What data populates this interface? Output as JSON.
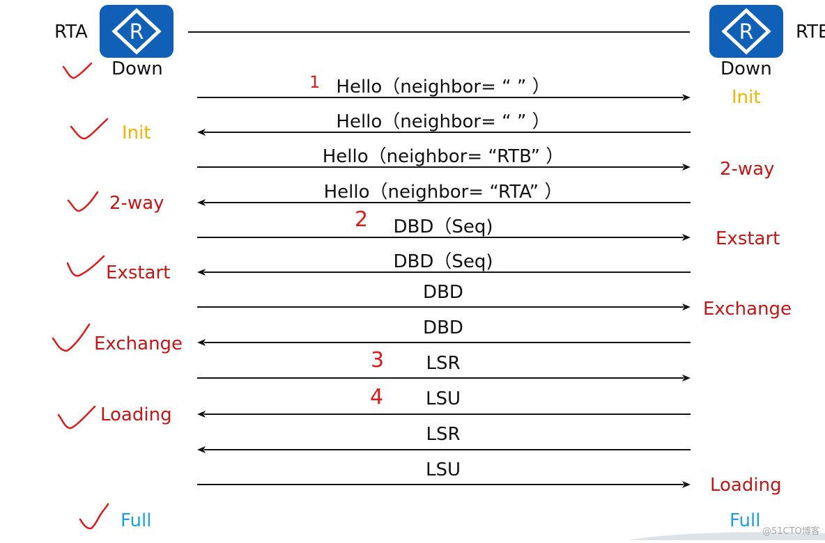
{
  "routers": {
    "left": {
      "label": "RTA",
      "icon_letter": "R",
      "icon": "router-icon",
      "color": "#1060b8"
    },
    "right": {
      "label": "RTB",
      "icon_letter": "R",
      "icon": "router-icon",
      "color": "#1060b8"
    }
  },
  "left_states": [
    {
      "label": "Down",
      "color": "black",
      "checked": true
    },
    {
      "label": "Init",
      "color": "yellow",
      "checked": true
    },
    {
      "label": "2-way",
      "color": "red",
      "checked": true
    },
    {
      "label": "Exstart",
      "color": "red",
      "checked": true
    },
    {
      "label": "Exchange",
      "color": "red",
      "checked": true
    },
    {
      "label": "Loading",
      "color": "red",
      "checked": true
    },
    {
      "label": "Full",
      "color": "blue",
      "checked": true
    }
  ],
  "right_states": [
    {
      "label": "Down",
      "color": "black"
    },
    {
      "label": "Init",
      "color": "yellow"
    },
    {
      "label": "2-way",
      "color": "red"
    },
    {
      "label": "Exstart",
      "color": "red"
    },
    {
      "label": "Exchange",
      "color": "red"
    },
    {
      "label": "Loading",
      "color": "red"
    },
    {
      "label": "Full",
      "color": "blue"
    }
  ],
  "messages": [
    {
      "text": "Hello（neighbor= “ ” ）",
      "direction": "right",
      "step": "1"
    },
    {
      "text": "Hello（neighbor= “ ” ）",
      "direction": "left",
      "step": ""
    },
    {
      "text": "Hello（neighbor= “RTB” ）",
      "direction": "right",
      "step": ""
    },
    {
      "text": "Hello（neighbor= “RTA” ）",
      "direction": "left",
      "step": ""
    },
    {
      "text": "DBD（Seq)",
      "direction": "right",
      "step": "2"
    },
    {
      "text": "DBD（Seq)",
      "direction": "left",
      "step": ""
    },
    {
      "text": "DBD",
      "direction": "right",
      "step": ""
    },
    {
      "text": "DBD",
      "direction": "left",
      "step": ""
    },
    {
      "text": "LSR",
      "direction": "right",
      "step": "3"
    },
    {
      "text": "LSU",
      "direction": "left",
      "step": "4"
    },
    {
      "text": "LSR",
      "direction": "left",
      "step": ""
    },
    {
      "text": "LSU",
      "direction": "right",
      "step": ""
    }
  ],
  "watermark": "@51CTO博客",
  "colors": {
    "black": "#111111",
    "yellow": "#f2b400",
    "red": "#c81414",
    "blue": "#1a9fe8",
    "annotation": "#e01818"
  }
}
